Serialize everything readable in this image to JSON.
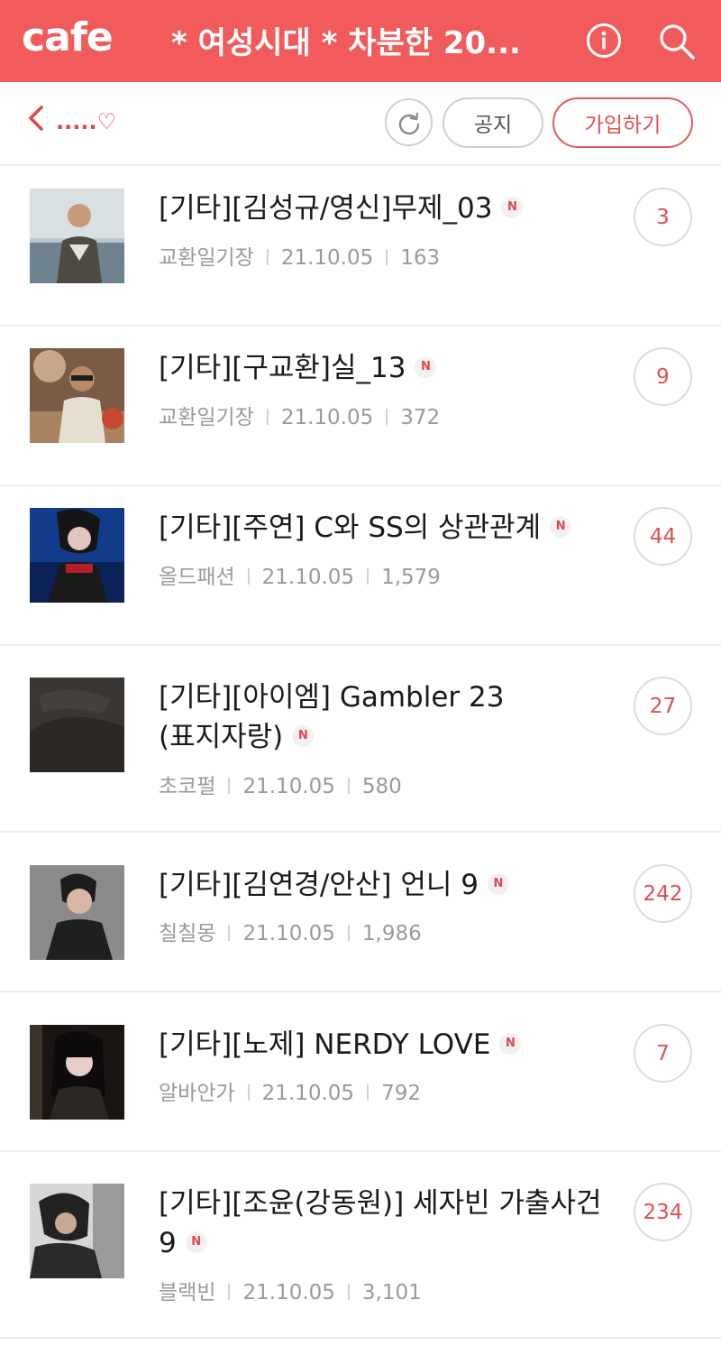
{
  "appbar": {
    "logo": "cafe",
    "title": "* 여성시대 * 차분한 20...",
    "info_icon": "info-icon",
    "search_icon": "search-icon"
  },
  "subbar": {
    "back_icon": "chevron-left-icon",
    "crumb": ".....♡",
    "refresh_icon": "refresh-icon",
    "notice_label": "공지",
    "join_label": "가입하기"
  },
  "colors": {
    "brand": "#f25b5b",
    "accent_text": "#e05050",
    "meta_text": "#9a9a9a"
  },
  "posts": [
    {
      "title": "[기타][김성규/영신]무제_03",
      "author": "교환일기장",
      "date": "21.10.05",
      "views": "163",
      "comments": "3",
      "new_badge": "N"
    },
    {
      "title": "[기타][구교환]실_13",
      "author": "교환일기장",
      "date": "21.10.05",
      "views": "372",
      "comments": "9",
      "new_badge": "N"
    },
    {
      "title": "[기타][주연] C와 SS의 상관관계",
      "author": "올드패션",
      "date": "21.10.05",
      "views": "1,579",
      "comments": "44",
      "new_badge": "N"
    },
    {
      "title": "[기타][아이엠] Gambler 23 (표지자랑)",
      "author": "초코펄",
      "date": "21.10.05",
      "views": "580",
      "comments": "27",
      "new_badge": "N"
    },
    {
      "title": "[기타][김연경/안산] 언니 9",
      "author": "칠칠몽",
      "date": "21.10.05",
      "views": "1,986",
      "comments": "242",
      "new_badge": "N"
    },
    {
      "title": "[기타][노제] NERDY LOVE",
      "author": "알바안가",
      "date": "21.10.05",
      "views": "792",
      "comments": "7",
      "new_badge": "N"
    },
    {
      "title": "[기타][조윤(강동원)] 세자빈 가출사건 9",
      "author": "블랙빈",
      "date": "21.10.05",
      "views": "3,101",
      "comments": "234",
      "new_badge": "N"
    }
  ]
}
